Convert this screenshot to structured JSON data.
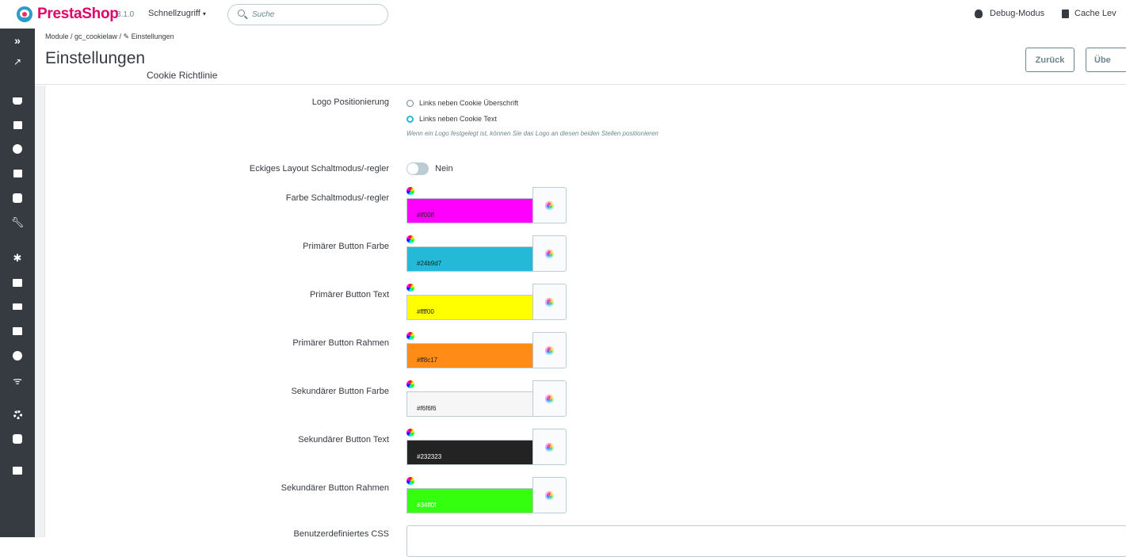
{
  "topbar": {
    "brand": "PrestaShop",
    "version": "8.1.0",
    "quick_access": "Schnellzugriff",
    "search_placeholder": "Suche",
    "debug": "Debug-Modus",
    "cache": "Cache Lev"
  },
  "header": {
    "breadcrumb": "Module  /  gc_cookielaw  /  ✎ Einstellungen",
    "title": "Einstellungen",
    "subtitle": "Cookie Richtlinie",
    "back_label": "Zurück",
    "next_label": "Übe"
  },
  "form": {
    "logo_position": {
      "label": "Logo Positionierung",
      "options": [
        "Links neben Cookie Überschrift",
        "Links neben Cookie Text"
      ],
      "selected": 1,
      "help": "Wenn ein Logo festgelegt ist, können Sie das Logo an diesen beiden Stellen positionieren"
    },
    "square_layout": {
      "label": "Eckiges Layout Schaltmodus/-regler",
      "value": "Nein"
    },
    "colors": [
      {
        "label": "Farbe Schaltmodus/-regler",
        "value": "#ff00ff",
        "text": "#ff00ff",
        "text_color": "#222222"
      },
      {
        "label": "Primärer Button Farbe",
        "value": "#24b9d7",
        "text": "#24b9d7",
        "text_color": "#222222"
      },
      {
        "label": "Primärer Button Text",
        "value": "#ffff00",
        "text": "#ffff00",
        "text_color": "#222222"
      },
      {
        "label": "Primärer Button Rahmen",
        "value": "#ff8c17",
        "text": "#ff8c17",
        "text_color": "#222222"
      },
      {
        "label": "Sekundärer Button Farbe",
        "value": "#f6f6f6",
        "text": "#f6f6f6",
        "text_color": "#222222"
      },
      {
        "label": "Sekundärer Button Text",
        "value": "#232323",
        "text": "#232323",
        "text_color": "#ffffff"
      },
      {
        "label": "Sekundärer Button Rahmen",
        "value": "#34ff0f",
        "text": "#34ff0f",
        "text_color": "#ffffff"
      }
    ],
    "custom_css": {
      "label": "Benutzerdefiniertes CSS"
    }
  },
  "sidebar_icons": [
    "expand-icon",
    "stats-icon",
    "orders-icon",
    "catalog-icon",
    "customers-icon",
    "messages-icon",
    "statistics-icon",
    "tools-icon",
    "modules-icon",
    "design-icon",
    "shipping-icon",
    "payment-icon",
    "international-icon",
    "wifi-icon",
    "settings-icon",
    "advanced-icon",
    "chat-icon"
  ]
}
